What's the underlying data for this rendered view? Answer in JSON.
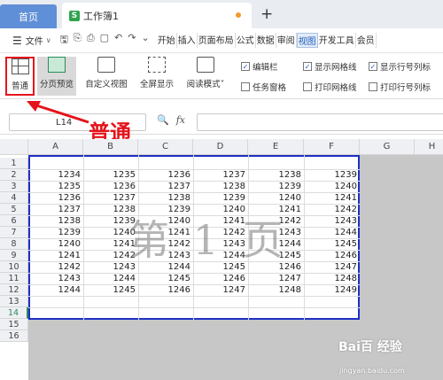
{
  "tabs": {
    "home_label": "首页",
    "doc_icon_letter": "S",
    "doc_label": "工作簿1",
    "add_symbol": "+"
  },
  "menubar": {
    "file_label": "文件",
    "tabs": [
      "开始",
      "插入",
      "页面布局",
      "公式",
      "数据",
      "审阅",
      "视图",
      "开发工具",
      "会员"
    ],
    "active_tab": "视图"
  },
  "ribbon": {
    "buttons": {
      "normal": "普通",
      "page_preview": "分页预览",
      "custom_view": "自定义视图",
      "fullscreen": "全屏显示",
      "reading_mode": "阅读模式"
    },
    "options": {
      "edit_bar": "编辑栏",
      "show_gridlines": "显示网格线",
      "show_headers": "显示行号列标",
      "task_pane": "任务窗格",
      "print_gridlines": "打印网格线",
      "print_headers": "打印行号列标"
    }
  },
  "formula_bar": {
    "cell_ref": "L14",
    "fx_label": "fx"
  },
  "annotation": {
    "label": "普通"
  },
  "sheet": {
    "columns": [
      "A",
      "B",
      "C",
      "D",
      "E",
      "F",
      "G",
      "H"
    ],
    "rows": [
      "1",
      "2",
      "3",
      "4",
      "5",
      "6",
      "7",
      "8",
      "9",
      "10",
      "11",
      "12",
      "13",
      "14",
      "15",
      "16"
    ],
    "selected_row": "14",
    "data": [
      [
        "1234",
        "1235",
        "1236",
        "1237",
        "1238",
        "1239"
      ],
      [
        "1235",
        "1236",
        "1237",
        "1238",
        "1239",
        "1240"
      ],
      [
        "1236",
        "1237",
        "1238",
        "1239",
        "1240",
        "1241"
      ],
      [
        "1237",
        "1238",
        "1239",
        "1240",
        "1241",
        "1242"
      ],
      [
        "1238",
        "1239",
        "1240",
        "1241",
        "1242",
        "1243"
      ],
      [
        "1239",
        "1240",
        "1241",
        "1242",
        "1243",
        "1244"
      ],
      [
        "1240",
        "1241",
        "1242",
        "1243",
        "1244",
        "1245"
      ],
      [
        "1241",
        "1242",
        "1243",
        "1244",
        "1245",
        "1246"
      ],
      [
        "1242",
        "1243",
        "1244",
        "1245",
        "1246",
        "1247"
      ],
      [
        "1243",
        "1244",
        "1245",
        "1246",
        "1247",
        "1248"
      ],
      [
        "1244",
        "1245",
        "1246",
        "1247",
        "1248",
        "1249"
      ]
    ],
    "watermark": "第 1 页"
  },
  "watermark_brand": {
    "main": "Bai百 经验",
    "sub": "jingyan.baidu.com"
  }
}
